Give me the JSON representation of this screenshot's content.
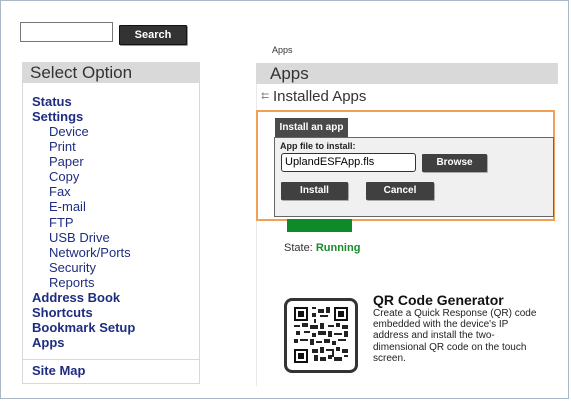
{
  "search": {
    "placeholder": "",
    "value": "",
    "button_label": "Search"
  },
  "sidebar": {
    "title": "Select Option",
    "items": [
      {
        "label": "Status",
        "level": 0
      },
      {
        "label": "Settings",
        "level": 0
      },
      {
        "label": "Device",
        "level": 1
      },
      {
        "label": "Print",
        "level": 1
      },
      {
        "label": "Paper",
        "level": 1
      },
      {
        "label": "Copy",
        "level": 1
      },
      {
        "label": "Fax",
        "level": 1
      },
      {
        "label": "E-mail",
        "level": 1
      },
      {
        "label": "FTP",
        "level": 1
      },
      {
        "label": "USB Drive",
        "level": 1
      },
      {
        "label": "Network/Ports",
        "level": 1
      },
      {
        "label": "Security",
        "level": 1
      },
      {
        "label": "Reports",
        "level": 1
      },
      {
        "label": "Address Book",
        "level": 0
      },
      {
        "label": "Shortcuts",
        "level": 0
      },
      {
        "label": "Bookmark Setup",
        "level": 0
      },
      {
        "label": "Apps",
        "level": 0
      }
    ],
    "site_map": "Site Map"
  },
  "main": {
    "breadcrumb": "Apps",
    "title": "Apps",
    "section": "Installed Apps",
    "install_dialog": {
      "tab_label": "Install an app",
      "file_label": "App file to install:",
      "file_value": "UplandESFApp.fls",
      "browse_label": "Browse",
      "install_label": "Install",
      "cancel_label": "Cancel"
    },
    "state_label": "State:",
    "state_value": "Running",
    "qr_app": {
      "title": "QR Code Generator",
      "description": "Create a Quick Response (QR) code embedded with the device's IP address and install the two-dimensional QR code on the touch screen."
    }
  },
  "colors": {
    "nav_link": "#1f2d80",
    "highlight": "#f0a155",
    "running": "#1a8a2b"
  }
}
